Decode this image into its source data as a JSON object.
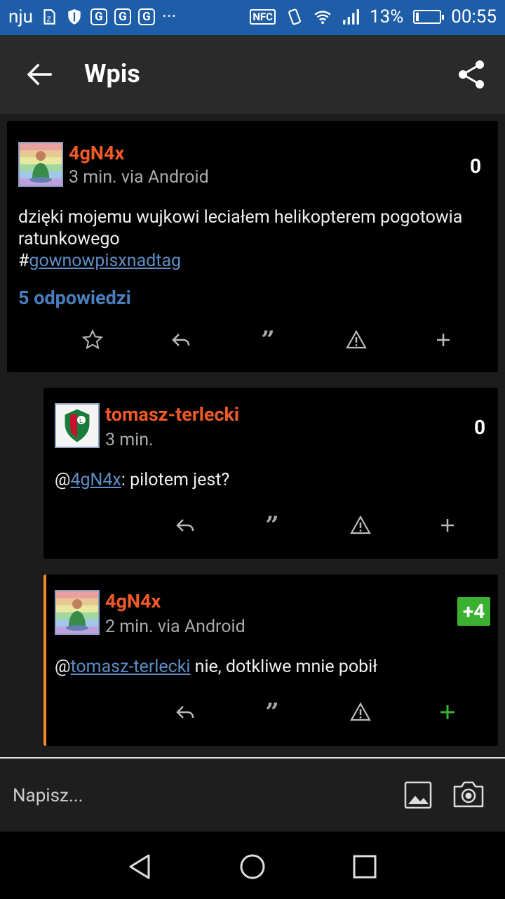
{
  "status_bar": {
    "carrier": "nju",
    "nfc": "NFC",
    "battery_percent": "13%",
    "battery_level": 0.13,
    "time": "00:55",
    "g_icons": [
      "G",
      "G",
      "G"
    ],
    "more": "···"
  },
  "app_bar": {
    "title": "Wpis"
  },
  "posts": [
    {
      "author": "4gN4x",
      "meta": "3 min. via Android",
      "score": "0",
      "text_line1": "dzięki mojemu wujkowi leciałem helikopterem pogotowia ratunkowego",
      "hash": "#",
      "tag": "gownowpisxnadtag",
      "replies": "5 odpowiedzi"
    },
    {
      "author": "tomasz-terlecki",
      "meta": "3 min.",
      "score": "0",
      "mention_prefix": "@",
      "mention": "4gN4x",
      "text_rest": ": pilotem jest?"
    },
    {
      "author": "4gN4x",
      "meta": "2 min. via Android",
      "score": "+4",
      "mention_prefix": "@",
      "mention": "tomasz-terlecki",
      "text_rest": " nie, dotkliwe mnie pobił"
    }
  ],
  "actions": {
    "quote_glyph": "”"
  },
  "compose": {
    "placeholder": "Napisz..."
  },
  "colors": {
    "status_bar": "#1e5ea8",
    "username": "#ef5a26",
    "link": "#5e8ec6",
    "plus_score": "#3cb030",
    "reply_marker": "#ef8a2d"
  }
}
